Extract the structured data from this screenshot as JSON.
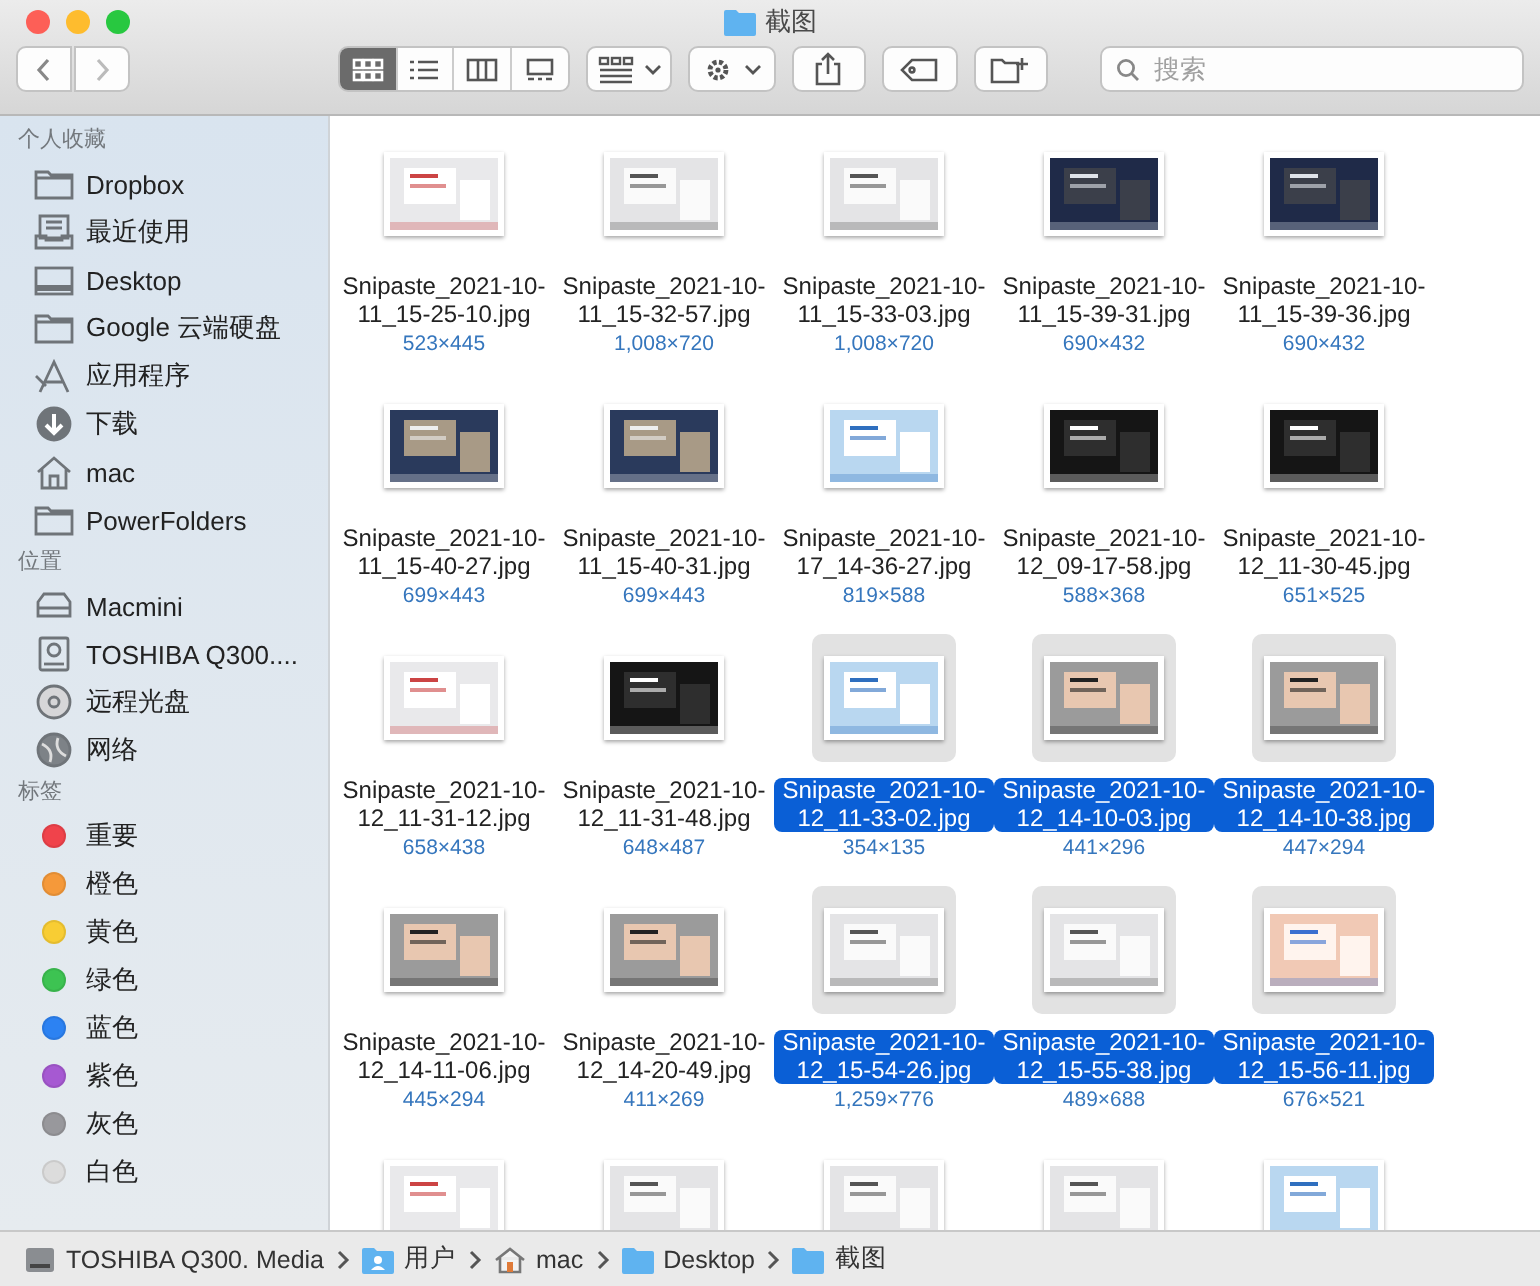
{
  "window": {
    "title": "截图"
  },
  "toolbar": {
    "view_modes": [
      {
        "kind": "icons",
        "selected": true
      },
      {
        "kind": "list",
        "selected": false
      },
      {
        "kind": "columns",
        "selected": false
      },
      {
        "kind": "gallery",
        "selected": false
      }
    ],
    "search": {
      "placeholder": "搜索"
    }
  },
  "sidebar": {
    "sections": [
      {
        "title": "个人收藏",
        "items": [
          {
            "kind": "folder",
            "label": "Dropbox"
          },
          {
            "kind": "recents",
            "label": "最近使用"
          },
          {
            "kind": "desktop",
            "label": "Desktop"
          },
          {
            "kind": "folder",
            "label": "Google 云端硬盘"
          },
          {
            "kind": "apps",
            "label": "应用程序"
          },
          {
            "kind": "downloads",
            "label": "下载"
          },
          {
            "kind": "home",
            "label": "mac"
          },
          {
            "kind": "folder",
            "label": "PowerFolders"
          }
        ]
      },
      {
        "title": "位置",
        "items": [
          {
            "kind": "server",
            "label": "Macmini"
          },
          {
            "kind": "disk",
            "label": "TOSHIBA Q300...."
          },
          {
            "kind": "disc",
            "label": "远程光盘"
          },
          {
            "kind": "network",
            "label": "网络"
          }
        ]
      },
      {
        "title": "标签",
        "items": [
          {
            "kind": "tag",
            "label": "重要",
            "color": "#f0434b"
          },
          {
            "kind": "tag",
            "label": "橙色",
            "color": "#f5993a"
          },
          {
            "kind": "tag",
            "label": "黄色",
            "color": "#f8cd34"
          },
          {
            "kind": "tag",
            "label": "绿色",
            "color": "#3dc352"
          },
          {
            "kind": "tag",
            "label": "蓝色",
            "color": "#2c82f2"
          },
          {
            "kind": "tag",
            "label": "紫色",
            "color": "#a659d2"
          },
          {
            "kind": "tag",
            "label": "灰色",
            "color": "#98989c"
          },
          {
            "kind": "tag",
            "label": "白色",
            "color": "#dcdcdc"
          }
        ]
      }
    ]
  },
  "files": [
    {
      "name": "Snipaste_2021-10-11_15-25-10.jpg",
      "size": "523×445",
      "selected": false
    },
    {
      "name": "Snipaste_2021-10-11_15-32-57.jpg",
      "size": "1,008×720",
      "selected": false
    },
    {
      "name": "Snipaste_2021-10-11_15-33-03.jpg",
      "size": "1,008×720",
      "selected": false
    },
    {
      "name": "Snipaste_2021-10-11_15-39-31.jpg",
      "size": "690×432",
      "selected": false
    },
    {
      "name": "Snipaste_2021-10-11_15-39-36.jpg",
      "size": "690×432",
      "selected": false
    },
    {
      "name": "Snipaste_2021-10-11_15-40-27.jpg",
      "size": "699×443",
      "selected": false
    },
    {
      "name": "Snipaste_2021-10-11_15-40-31.jpg",
      "size": "699×443",
      "selected": false
    },
    {
      "name": "Snipaste_2021-10-17_14-36-27.jpg",
      "size": "819×588",
      "selected": false
    },
    {
      "name": "Snipaste_2021-10-12_09-17-58.jpg",
      "size": "588×368",
      "selected": false
    },
    {
      "name": "Snipaste_2021-10-12_11-30-45.jpg",
      "size": "651×525",
      "selected": false
    },
    {
      "name": "Snipaste_2021-10-12_11-31-12.jpg",
      "size": "658×438",
      "selected": false
    },
    {
      "name": "Snipaste_2021-10-12_11-31-48.jpg",
      "size": "648×487",
      "selected": false
    },
    {
      "name": "Snipaste_2021-10-12_11-33-02.jpg",
      "size": "354×135",
      "selected": true
    },
    {
      "name": "Snipaste_2021-10-12_14-10-03.jpg",
      "size": "441×296",
      "selected": true
    },
    {
      "name": "Snipaste_2021-10-12_14-10-38.jpg",
      "size": "447×294",
      "selected": true
    },
    {
      "name": "Snipaste_2021-10-12_14-11-06.jpg",
      "size": "445×294",
      "selected": false
    },
    {
      "name": "Snipaste_2021-10-12_14-20-49.jpg",
      "size": "411×269",
      "selected": false
    },
    {
      "name": "Snipaste_2021-10-12_15-54-26.jpg",
      "size": "1,259×776",
      "selected": true
    },
    {
      "name": "Snipaste_2021-10-12_15-55-38.jpg",
      "size": "489×688",
      "selected": true
    },
    {
      "name": "Snipaste_2021-10-12_15-56-11.jpg",
      "size": "676×521",
      "selected": true
    },
    {
      "kind": "picture"
    },
    {
      "kind": "picture"
    },
    {
      "kind": "picture"
    },
    {
      "kind": "picture"
    },
    {
      "kind": "picture"
    }
  ],
  "path_bar": [
    {
      "kind": "disk",
      "label": "TOSHIBA Q300. Media"
    },
    {
      "kind": "users",
      "label": "用户"
    },
    {
      "kind": "home",
      "label": "mac"
    },
    {
      "kind": "folder",
      "label": "Desktop"
    },
    {
      "kind": "folder",
      "label": "截图"
    }
  ]
}
